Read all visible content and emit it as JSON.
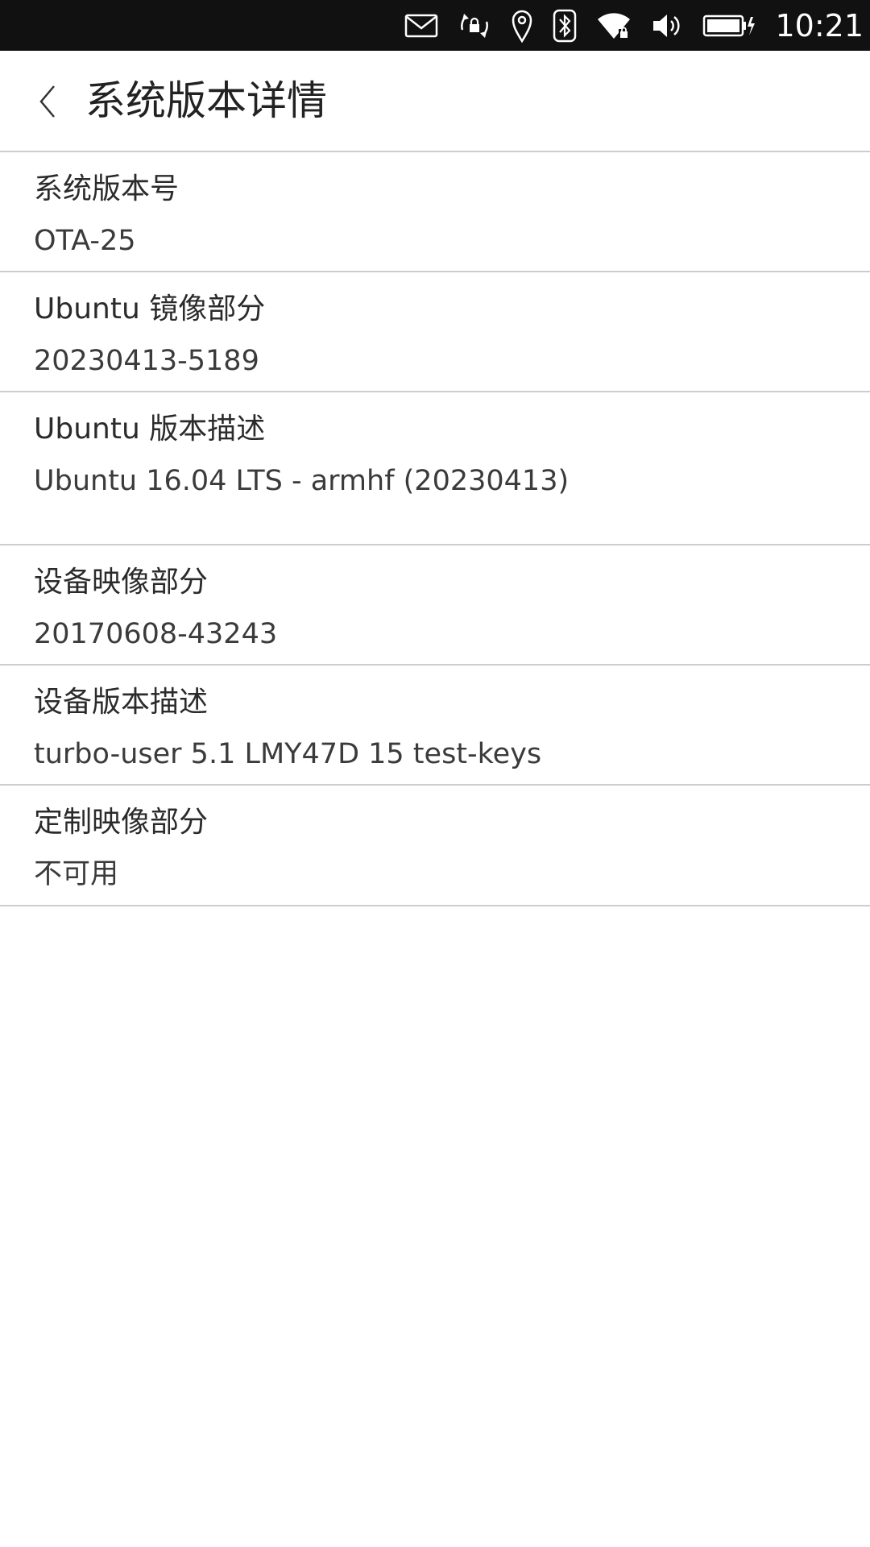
{
  "status_bar": {
    "time": "10:21",
    "icons": [
      "mail-icon",
      "rotation-lock-icon",
      "location-icon",
      "bluetooth-icon",
      "wifi-icon",
      "volume-icon",
      "battery-charging-icon"
    ]
  },
  "header": {
    "back_glyph": "〈",
    "title": "系统版本详情"
  },
  "rows": [
    {
      "label": "系统版本号",
      "value": "OTA-25"
    },
    {
      "label": "Ubuntu 镜像部分",
      "value": "20230413-5189"
    },
    {
      "label": "Ubuntu 版本描述",
      "value": "Ubuntu 16.04 LTS - armhf (20230413)"
    },
    {
      "label": "设备映像部分",
      "value": "20170608-43243"
    },
    {
      "label": "设备版本描述",
      "value": "turbo-user 5.1 LMY47D 15 test-keys"
    },
    {
      "label": "定制映像部分",
      "value": "不可用"
    }
  ],
  "colors": {
    "status_bar_bg": "#111111",
    "divider": "#cdcdcd",
    "background": "#ffffff"
  }
}
